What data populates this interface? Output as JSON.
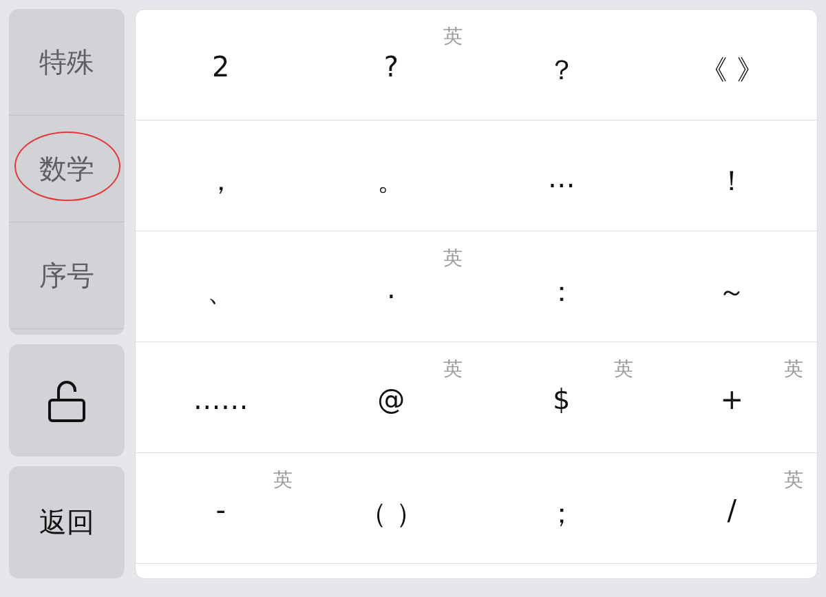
{
  "categories": [
    {
      "label": "特殊",
      "circled": false
    },
    {
      "label": "数学",
      "circled": true
    },
    {
      "label": "序号",
      "circled": false
    }
  ],
  "lock_button": {
    "locked": false
  },
  "back_button": {
    "label": "返回"
  },
  "symbols": [
    [
      {
        "symbol": "2"
      },
      {
        "symbol": "?",
        "tag": "英"
      },
      {
        "symbol": "？"
      },
      {
        "symbol": "《 》"
      }
    ],
    [
      {
        "symbol": "，"
      },
      {
        "symbol": "。"
      },
      {
        "symbol": "…"
      },
      {
        "symbol": "！"
      }
    ],
    [
      {
        "symbol": "、"
      },
      {
        "symbol": ".",
        "tag": "英"
      },
      {
        "symbol": "："
      },
      {
        "symbol": "～"
      }
    ],
    [
      {
        "symbol": "……"
      },
      {
        "symbol": "@",
        "tag": "英"
      },
      {
        "symbol": "$",
        "tag": "英"
      },
      {
        "symbol": "+",
        "tag": "英"
      }
    ],
    [
      {
        "symbol": "-",
        "tag": "英"
      },
      {
        "symbol": "（ ）"
      },
      {
        "symbol": "；"
      },
      {
        "symbol": "/",
        "tag": "英"
      }
    ]
  ]
}
